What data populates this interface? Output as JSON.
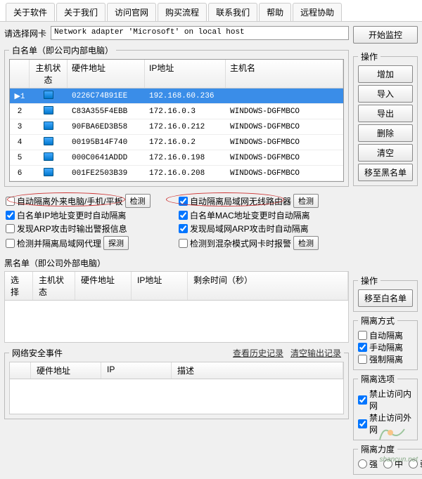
{
  "tabs": [
    "关于软件",
    "关于我们",
    "访问官网",
    "购买流程",
    "联系我们",
    "帮助",
    "远程协助"
  ],
  "adapter": {
    "label": "请选择网卡",
    "value": "Network adapter 'Microsoft' on local host",
    "start_btn": "开始监控"
  },
  "whitelist": {
    "title": "白名单（即公司内部电脑）",
    "cols": [
      "",
      "主机状态",
      "硬件地址",
      "IP地址",
      "主机名"
    ],
    "rows": [
      {
        "n": "1",
        "mac": "0226C74B91EE",
        "ip": "192.168.60.236",
        "host": "",
        "sel": true
      },
      {
        "n": "2",
        "mac": "C83A355F4EBB",
        "ip": "172.16.0.3",
        "host": "WINDOWS-DGFMBCO"
      },
      {
        "n": "3",
        "mac": "90FBA6ED3B58",
        "ip": "172.16.0.212",
        "host": "WINDOWS-DGFMBCO"
      },
      {
        "n": "4",
        "mac": "00195B14F740",
        "ip": "172.16.0.2",
        "host": "WINDOWS-DGFMBCO"
      },
      {
        "n": "5",
        "mac": "000C0641ADDD",
        "ip": "172.16.0.198",
        "host": "WINDOWS-DGFMBCO"
      },
      {
        "n": "6",
        "mac": "001FE2503B39",
        "ip": "172.16.0.208",
        "host": "WINDOWS-DGFMBCO"
      }
    ]
  },
  "ops": {
    "title": "操作",
    "btns": [
      "增加",
      "导入",
      "导出",
      "删除",
      "清空",
      "移至黑名单"
    ],
    "btn_towhite": "移至白名单"
  },
  "options": {
    "o1": "自动隔离外来电脑/手机/平板",
    "b1": "检测",
    "o2": "自动隔离局域网无线路由器",
    "b2": "检测",
    "o3": "白名单IP地址变更时自动隔离",
    "o4": "白名单MAC地址变更时自动隔离",
    "o5": "发现ARP攻击时输出警报信息",
    "o6": "发现局域网ARP攻击时自动隔离",
    "o7": "检测并隔离局域网代理",
    "b7": "探测",
    "o8": "检测到混杂模式网卡时报警",
    "b8": "检测"
  },
  "blacklist": {
    "title": "黑名单（即公司外部电脑）",
    "cols": [
      "选择",
      "主机状态",
      "硬件地址",
      "IP地址",
      "剩余时间（秒）"
    ]
  },
  "events": {
    "title": "网络安全事件",
    "link1": "查看历史记录",
    "link2": "清空输出记录",
    "cols": [
      "",
      "硬件地址",
      "IP",
      "描述"
    ]
  },
  "isolate_mode": {
    "title": "隔离方式",
    "o1": "自动隔离",
    "o2": "手动隔离",
    "o3": "强制隔离"
  },
  "isolate_opt": {
    "title": "隔离选项",
    "o1": "禁止访问内网",
    "o2": "禁止访问外网"
  },
  "isolate_level": {
    "title": "隔离力度",
    "r1": "强",
    "r2": "中",
    "r3": "弱"
  },
  "watermark": "shancun.net"
}
